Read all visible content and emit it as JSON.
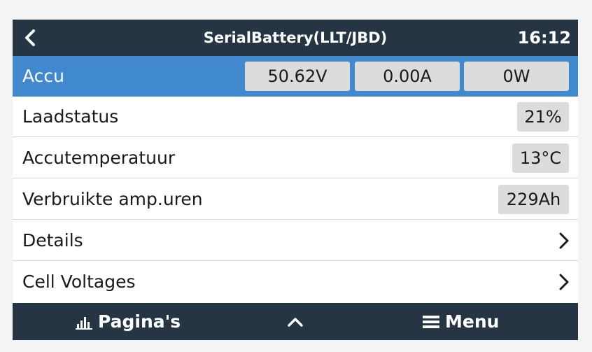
{
  "header": {
    "title": "SerialBattery(LLT/JBD)",
    "time": "16:12"
  },
  "rows": [
    {
      "label": "Accu",
      "values": [
        "50.62V",
        "0.00A",
        "0W"
      ]
    },
    {
      "label": "Laadstatus",
      "value": "21%"
    },
    {
      "label": "Accutemperatuur",
      "value": "13°C"
    },
    {
      "label": "Verbruikte amp.uren",
      "value": "229Ah"
    },
    {
      "label": "Details"
    },
    {
      "label": "Cell Voltages"
    }
  ],
  "footer": {
    "pages_label": "Pagina's",
    "menu_label": "Menu"
  },
  "colors": {
    "header_bg": "#263544",
    "selected_bg": "#4189ce",
    "value_box_bg": "#dcdcdc"
  }
}
